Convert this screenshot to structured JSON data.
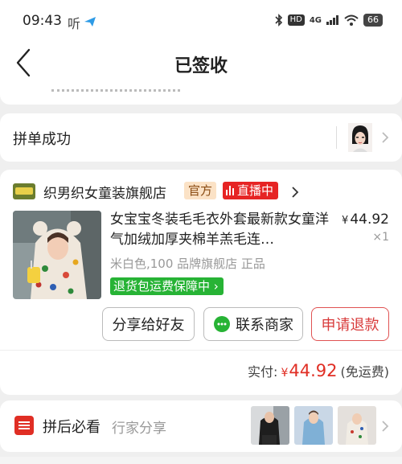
{
  "status_bar": {
    "time": "09:43",
    "listen_icon_text": "听",
    "hd_badge": "HD",
    "network": "4G",
    "battery": "66"
  },
  "nav": {
    "title": "已签收"
  },
  "group_buy": {
    "title": "拼单成功"
  },
  "order": {
    "shop_name": "织男织女童装旗舰店",
    "official_tag": "官方",
    "live_tag": "直播中",
    "product_title": "女宝宝冬装毛毛衣外套最新款女童洋气加绒加厚夹棉羊羔毛连…",
    "price_symbol": "¥",
    "price": "44.92",
    "quantity": "×1",
    "spec": "米白色,100 品牌旗舰店 正品",
    "guarantee": "退货包运费保障中",
    "buttons": {
      "share": "分享给好友",
      "contact": "联系商家",
      "refund": "申请退款"
    },
    "paid_label": "实付:",
    "paid_symbol": "¥",
    "paid_amount": "44.92",
    "shipping_note": "(免运费)"
  },
  "after_buy": {
    "title": "拼后必看",
    "subtitle": "行家分享"
  },
  "colors": {
    "brand_red": "#e02e24",
    "live_red": "#e62424",
    "guarantee_green": "#27b335",
    "official_bg": "#fbe2c6"
  }
}
